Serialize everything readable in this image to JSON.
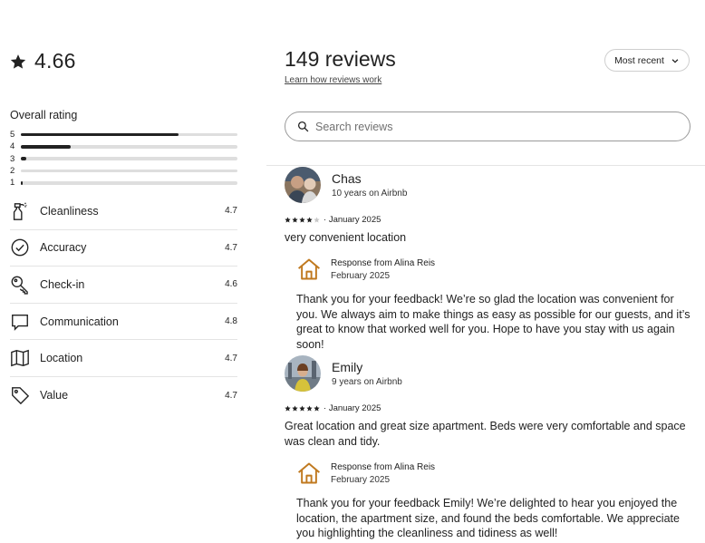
{
  "summary": {
    "rating": "4.66",
    "overall_label": "Overall rating",
    "distribution": [
      {
        "stars": "5",
        "fraction": 0.73
      },
      {
        "stars": "4",
        "fraction": 0.23
      },
      {
        "stars": "3",
        "fraction": 0.025
      },
      {
        "stars": "2",
        "fraction": 0.0
      },
      {
        "stars": "1",
        "fraction": 0.01
      }
    ],
    "categories": [
      {
        "icon": "spray-bottle-icon",
        "label": "Cleanliness",
        "value": "4.7"
      },
      {
        "icon": "check-circle-icon",
        "label": "Accuracy",
        "value": "4.7"
      },
      {
        "icon": "key-icon",
        "label": "Check-in",
        "value": "4.6"
      },
      {
        "icon": "chat-bubble-icon",
        "label": "Communication",
        "value": "4.8"
      },
      {
        "icon": "map-icon",
        "label": "Location",
        "value": "4.7"
      },
      {
        "icon": "tag-icon",
        "label": "Value",
        "value": "4.7"
      }
    ]
  },
  "header": {
    "title": "149 reviews",
    "learn_link": "Learn how reviews work",
    "sort_label": "Most recent"
  },
  "search": {
    "placeholder": "Search reviews"
  },
  "reviews": [
    {
      "name": "Chas",
      "since": "10 years on Airbnb",
      "stars": 4,
      "date": "January 2025",
      "text": "very convenient location",
      "response": {
        "from": "Response from Alina Reis",
        "date": "February 2025",
        "text": "Thank you for your feedback! We’re so glad the location was convenient for you. We always aim to make things as easy as possible for our guests, and it’s great to know that worked well for you. Hope to have you stay with us again soon!"
      }
    },
    {
      "name": "Emily",
      "since": "9 years on Airbnb",
      "stars": 5,
      "date": "January 2025",
      "text": "Great location and great size apartment. Beds were very comfortable and space was clean and tidy.",
      "response": {
        "from": "Response from Alina Reis",
        "date": "February 2025",
        "text": "Thank you for your feedback Emily! We’re delighted to hear you enjoyed the location, the apartment size, and found the beds comfortable. We appreciate you highlighting the cleanliness and tidiness as well!"
      }
    }
  ],
  "colors": {
    "accent_house": "#c0791f",
    "text": "#222222",
    "bar_track": "#dedede"
  }
}
